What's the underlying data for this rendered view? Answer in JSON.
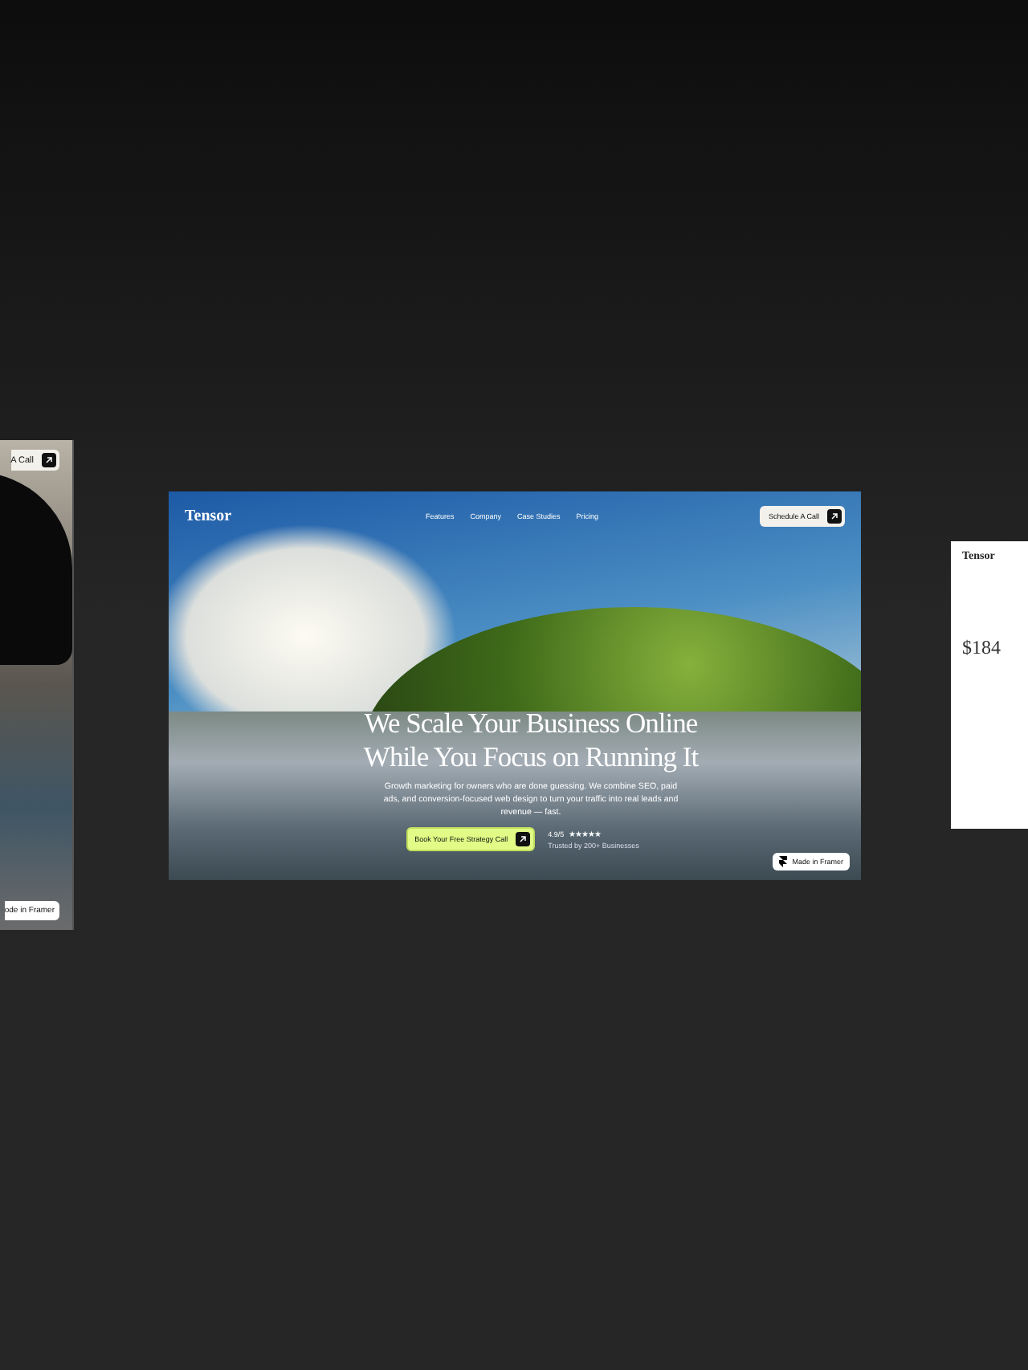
{
  "left_card": {
    "button_label": "A Call",
    "badge": "ode in Framer"
  },
  "main_card": {
    "logo": "Tensor",
    "nav": [
      {
        "label": "Features"
      },
      {
        "label": "Company"
      },
      {
        "label": "Case Studies"
      },
      {
        "label": "Pricing"
      }
    ],
    "cta": "Schedule A Call",
    "title_lines": [
      "We Scale Your Business Online",
      "While You Focus on Running It"
    ],
    "subtitle": "Growth marketing for owners who are done guessing. We combine SEO, paid ads, and conversion-focused web design to turn your traffic into real leads and revenue — fast.",
    "primary_button": "Book Your Free Strategy Call",
    "rating": "4.9/5",
    "stars": 5,
    "trusted": "Trusted by 200+ Businesses",
    "badge": "Made in Framer"
  },
  "right_card": {
    "logo": "Tensor",
    "value": "$184"
  }
}
